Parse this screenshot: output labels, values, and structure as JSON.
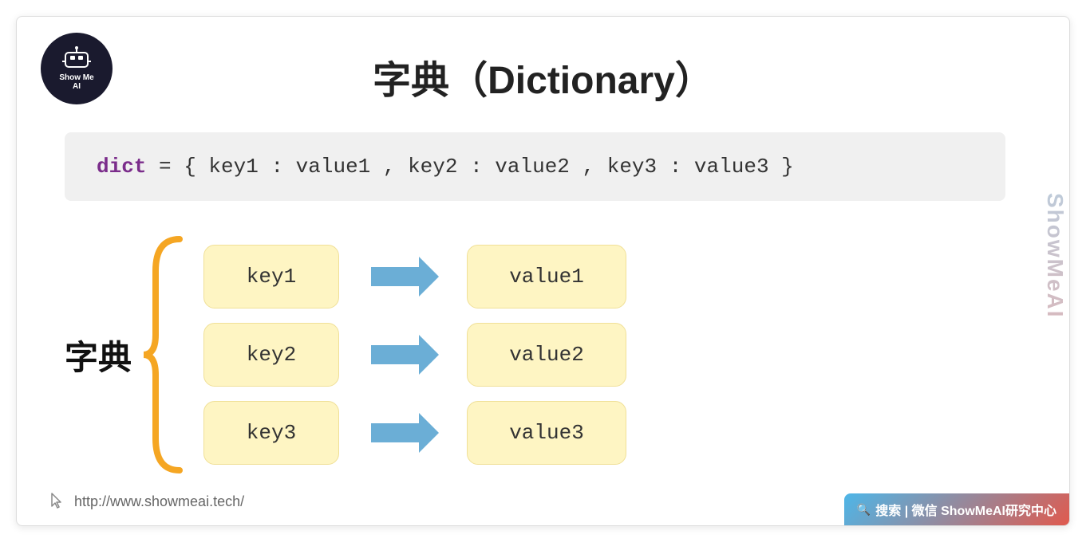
{
  "slide": {
    "title": "字典（Dictionary）",
    "logo": {
      "text": "ShowMe\nAI",
      "line1": "Show Me",
      "line2": "AI"
    },
    "code": {
      "keyword": "dict",
      "expression": " = { key1 : value1 , key2 : value2 , key3 : value3 }"
    },
    "diagram": {
      "label": "字典",
      "keys": [
        "key1",
        "key2",
        "key3"
      ],
      "values": [
        "value1",
        "value2",
        "value3"
      ]
    },
    "watermark": "ShowMeAI",
    "footer": {
      "url": "http://www.showmeai.tech/",
      "badge": "搜索 | 微信 ShowMeAI研究中心"
    }
  }
}
